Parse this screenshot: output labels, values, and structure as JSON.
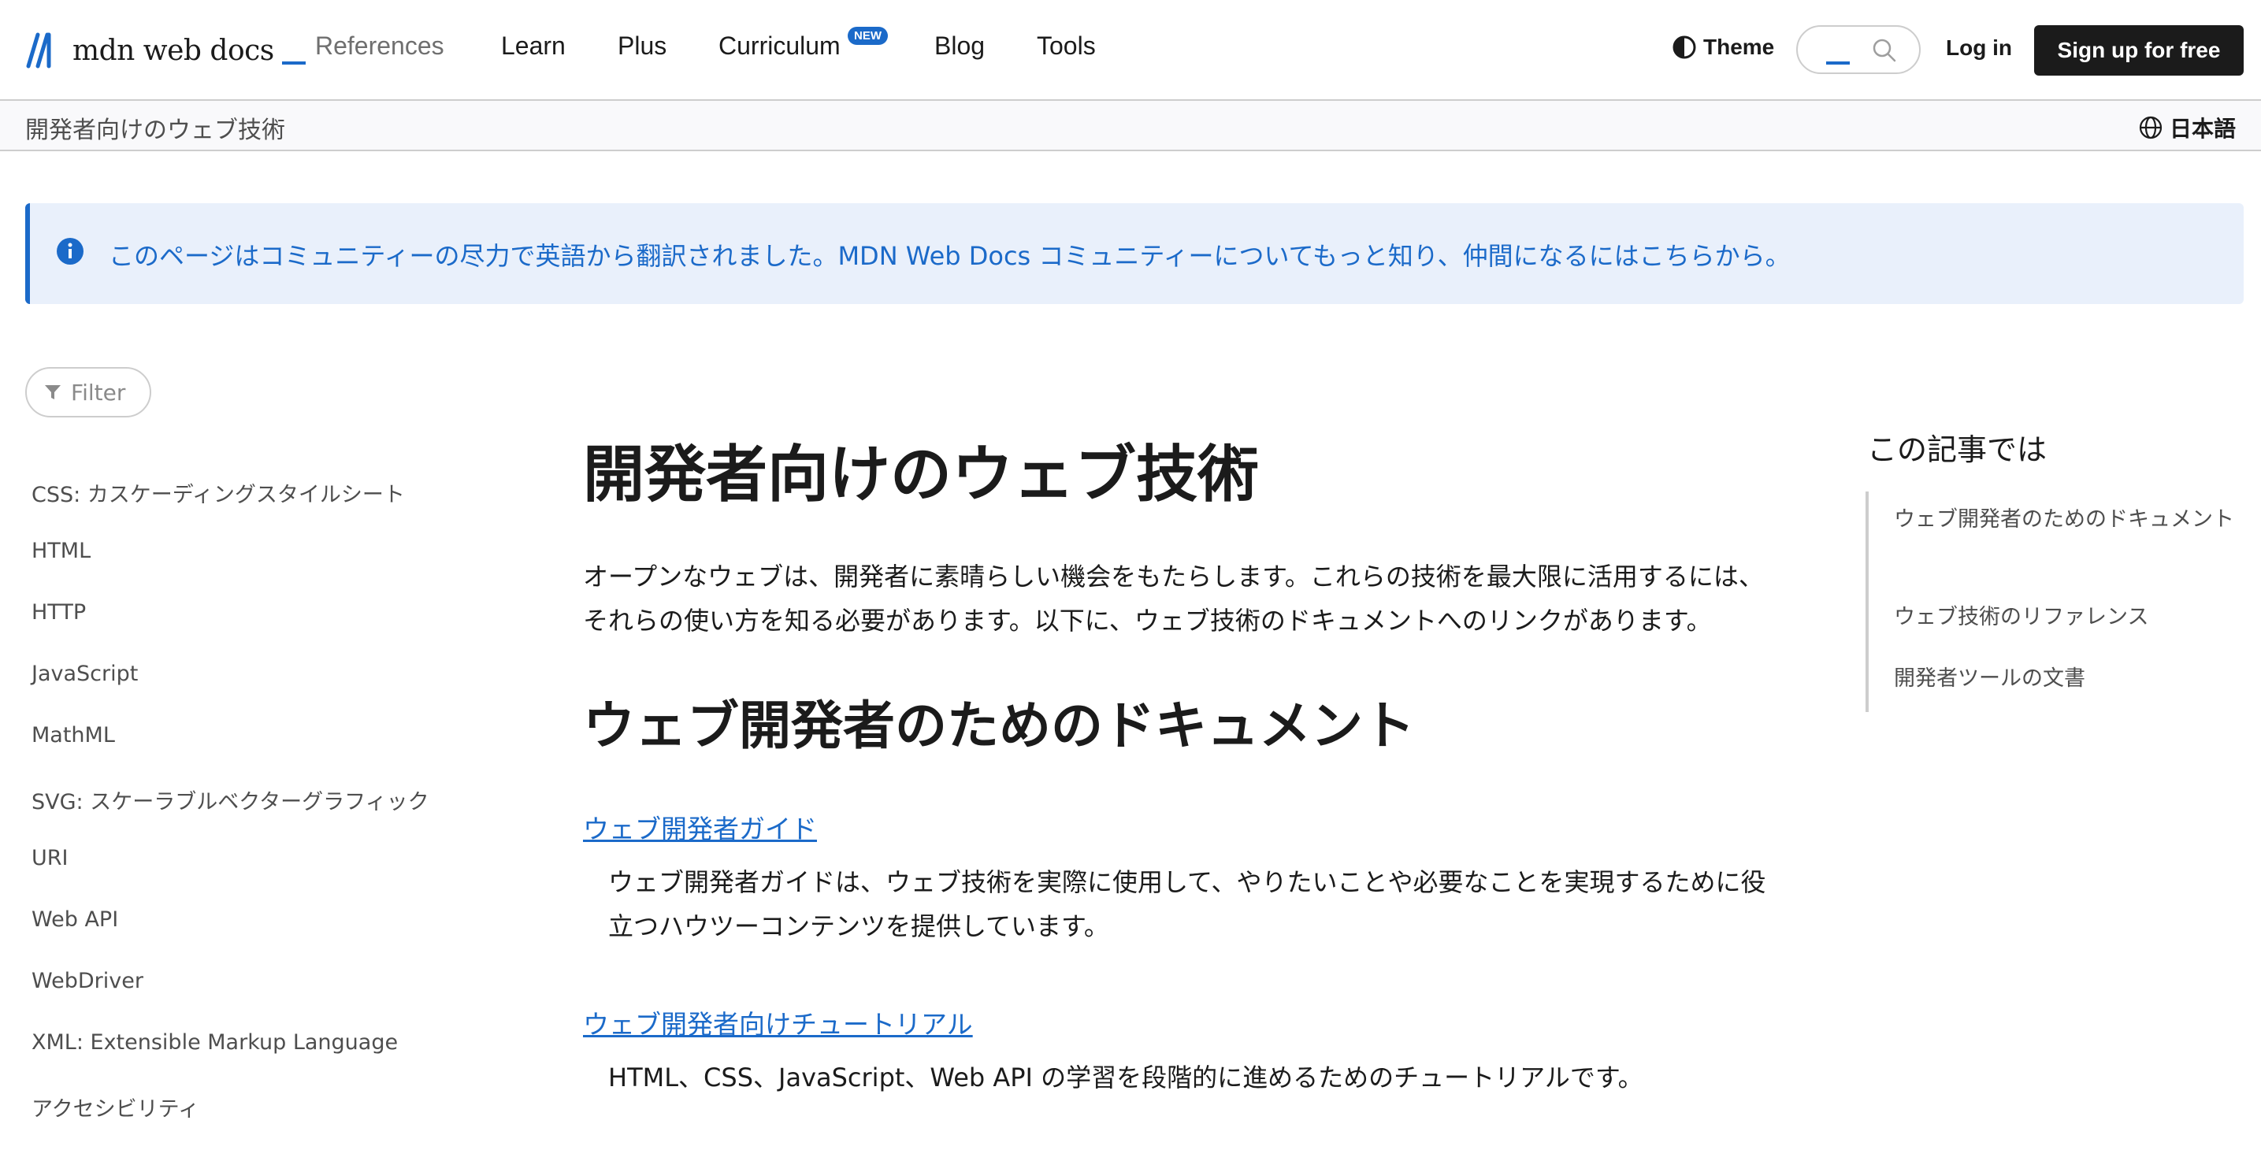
{
  "header": {
    "logo_text": "mdn web docs",
    "nav": [
      {
        "label": "References"
      },
      {
        "label": "Learn"
      },
      {
        "label": "Plus"
      },
      {
        "label": "Curriculum"
      },
      {
        "label": "Blog"
      },
      {
        "label": "Tools"
      }
    ],
    "new_badge": "NEW",
    "theme_label": "Theme",
    "login_label": "Log in",
    "signup_label": "Sign up for free"
  },
  "breadcrumb": {
    "current": "開発者向けのウェブ技術",
    "language": "日本語"
  },
  "notice": {
    "text": "このページはコミュニティーの尽力で英語から翻訳されました。MDN Web Docs コミュニティーについてもっと知り、仲間になるにはこちらから。"
  },
  "sidebar": {
    "filter_placeholder": "Filter",
    "items": [
      {
        "label": "CSS: カスケーディングスタイルシート"
      },
      {
        "label": "HTML"
      },
      {
        "label": "HTTP"
      },
      {
        "label": "JavaScript"
      },
      {
        "label": "MathML"
      },
      {
        "label": "SVG: スケーラブルベクターグラフィック"
      },
      {
        "label": "URI"
      },
      {
        "label": "Web API"
      },
      {
        "label": "WebDriver"
      },
      {
        "label": "XML: Extensible Markup Language"
      },
      {
        "label": "アクセシビリティ"
      }
    ]
  },
  "main": {
    "title": "開発者向けのウェブ技術",
    "intro": "オープンなウェブは、開発者に素晴らしい機会をもたらします。これらの技術を最大限に活用するには、それらの使い方を知る必要があります。以下に、ウェブ技術のドキュメントへのリンクがあります。",
    "section_title": "ウェブ開発者のためのドキュメント",
    "entries": [
      {
        "link": "ウェブ開発者ガイド",
        "description": "ウェブ開発者ガイドは、ウェブ技術を実際に使用して、やりたいことや必要なことを実現するために役立つハウツーコンテンツを提供しています。"
      },
      {
        "link": "ウェブ開発者向けチュートリアル",
        "description": "HTML、CSS、JavaScript、Web API の学習を段階的に進めるためのチュートリアルです。"
      }
    ]
  },
  "toc": {
    "title": "この記事では",
    "items": [
      {
        "label": "ウェブ開発者のためのドキュメント"
      },
      {
        "label": "ウェブ技術のリファレンス"
      },
      {
        "label": "開発者ツールの文書"
      }
    ]
  },
  "colors": {
    "accent": "#1b6ac9",
    "notice_bg": "#e9f0fb",
    "text": "#1b1b1b",
    "border": "#cdcdcd"
  },
  "icons": [
    "mdn-logo-icon",
    "theme-icon",
    "search-icon",
    "globe-icon",
    "info-icon",
    "filter-icon"
  ]
}
